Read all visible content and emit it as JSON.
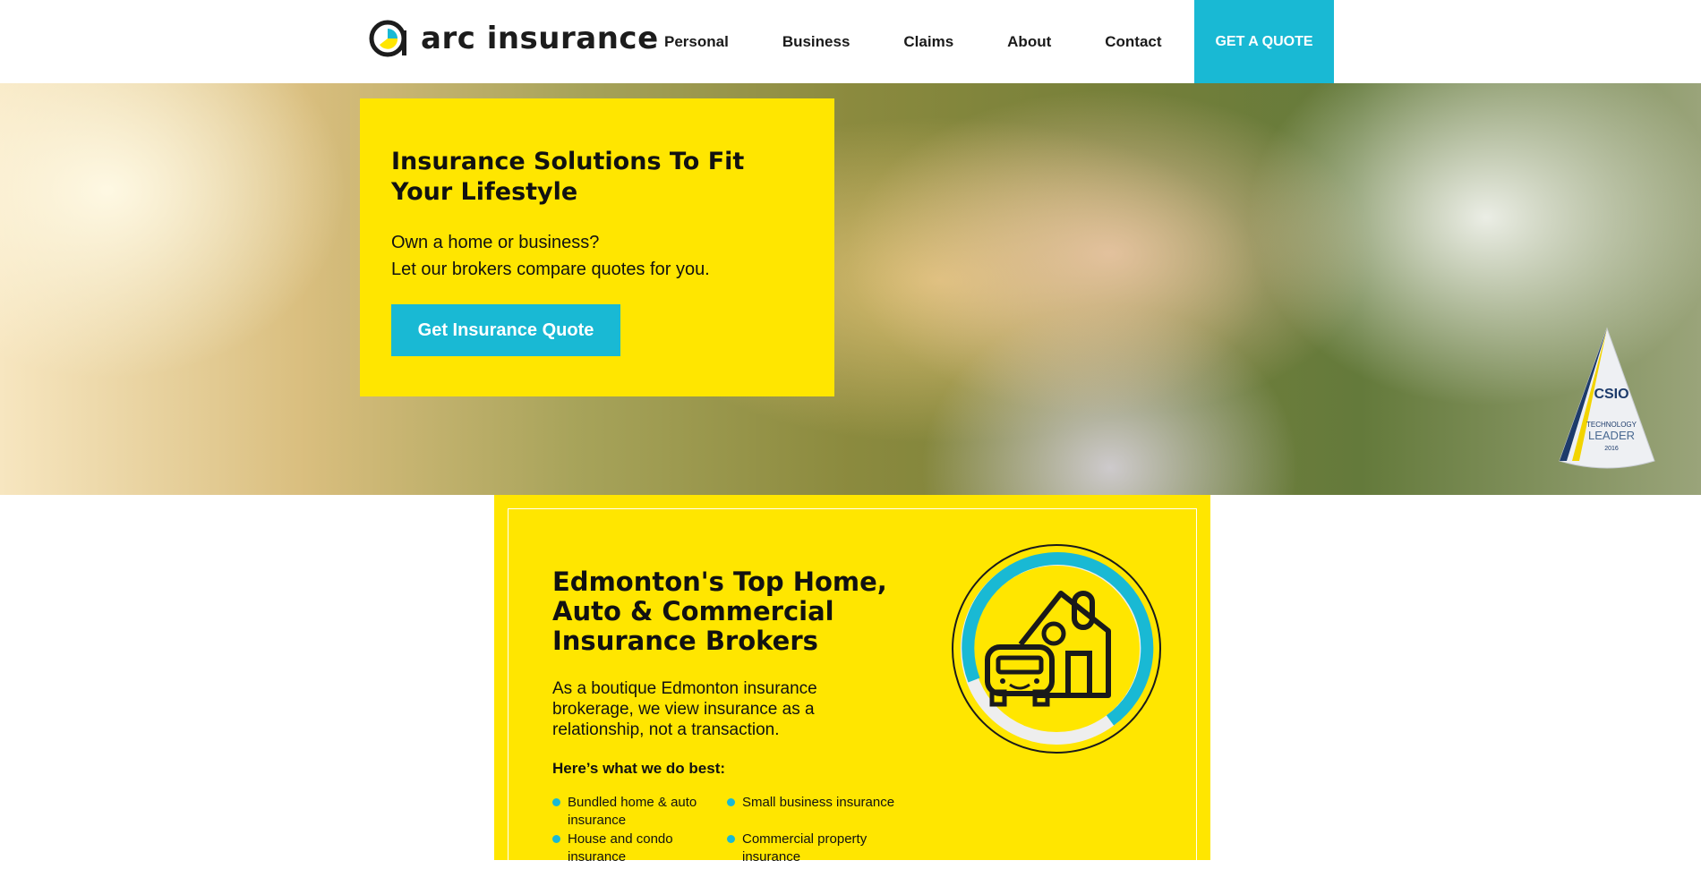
{
  "header": {
    "logo_text": "arc insurance",
    "nav": [
      "Personal",
      "Business",
      "Claims",
      "About",
      "Contact"
    ],
    "cta": "GET A QUOTE"
  },
  "hero": {
    "title": "Insurance Solutions To Fit Your Lifestyle",
    "line1": "Own a home or business?",
    "line2": "Let our brokers compare quotes for you.",
    "button": "Get Insurance Quote",
    "badge": {
      "brand": "CSIO",
      "line1": "TECHNOLOGY",
      "line2": "LEADER",
      "year": "2016"
    }
  },
  "section": {
    "title": "Edmonton's Top Home, Auto & Commercial Insurance Brokers",
    "description": "As a boutique Edmonton insurance brokerage, we view insurance as a relationship, not a transaction.",
    "best_label": "Here’s what we do best:",
    "bullets": [
      "Bundled home & auto insurance",
      "Small business insurance",
      "House and condo insurance",
      "Commercial property insurance"
    ]
  },
  "colors": {
    "brand_yellow": "#ffe600",
    "accent_cyan": "#19b9d4",
    "text": "#111111"
  }
}
